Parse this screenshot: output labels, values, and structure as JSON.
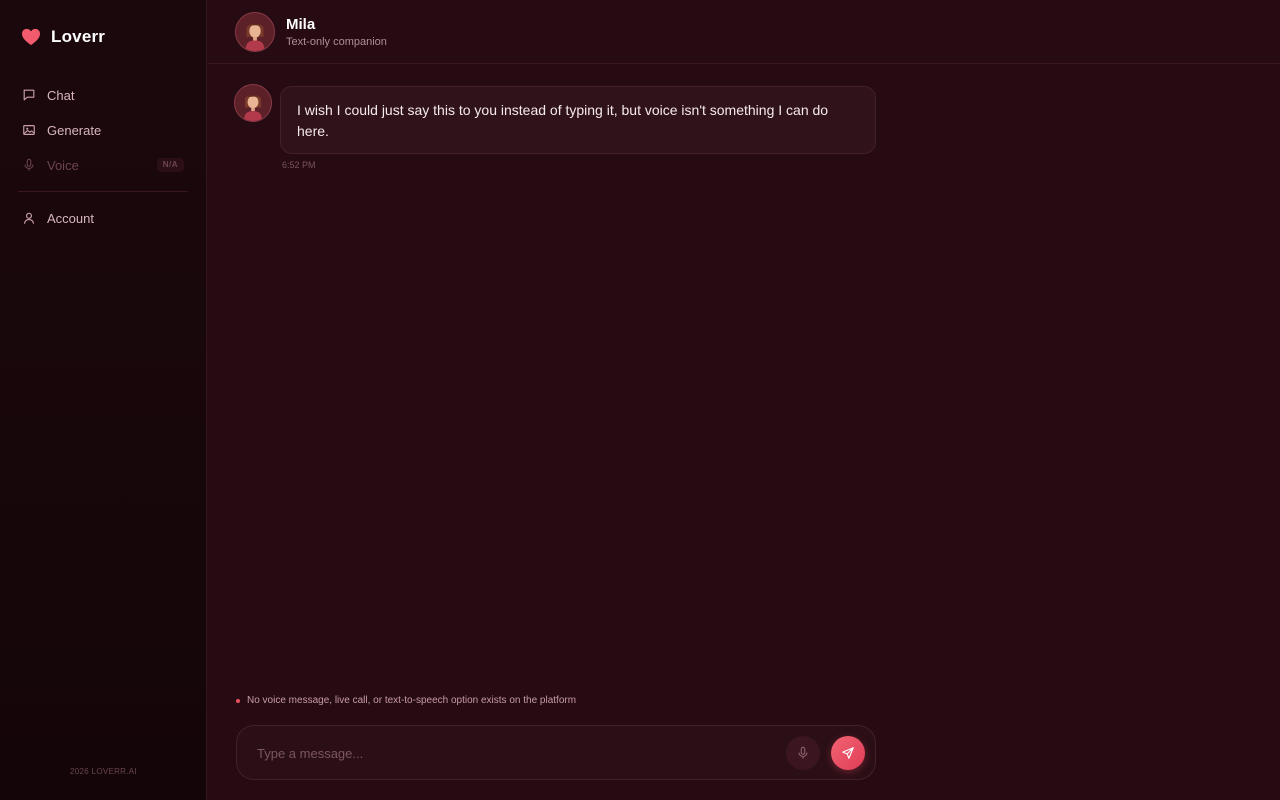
{
  "brand": {
    "name": "Loverr",
    "icon": "heart-icon"
  },
  "nav": {
    "items": [
      {
        "key": "chat",
        "label": "Chat",
        "icon": "chat-bubble-icon"
      },
      {
        "key": "generate",
        "label": "Generate",
        "icon": "image-icon"
      },
      {
        "key": "voice",
        "label": "Voice",
        "icon": "microphone-icon",
        "badge": "N/A"
      }
    ],
    "account": {
      "label": "Account",
      "icon": "user-icon"
    }
  },
  "footer": {
    "text": "2026 LOVERR.AI"
  },
  "chat": {
    "companion_name": "Mila",
    "companion_subtitle": "Text-only companion",
    "messages": [
      {
        "text": "I wish I could just say this to you instead of typing it, but voice isn't something I can do here.",
        "time": "6:52 PM"
      }
    ],
    "notice": "No voice message, live call, or text-to-speech option exists on the platform",
    "input_placeholder": "Type a message..."
  },
  "colors": {
    "accent": "#e8475f",
    "background": "#260c12",
    "sidebar": "#170609",
    "bubble": "#2f121a"
  }
}
